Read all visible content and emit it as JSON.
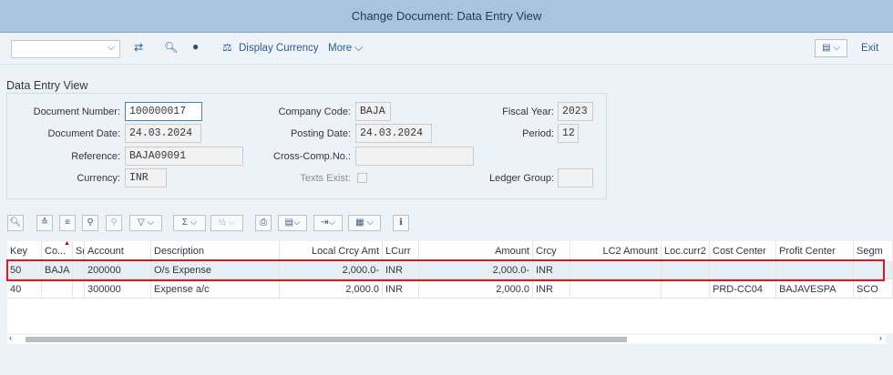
{
  "title": "Change Document: Data Entry View",
  "toolbar": {
    "display_currency": "Display Currency",
    "more": "More",
    "exit": "Exit"
  },
  "section_title": "Data Entry View",
  "header": {
    "document_number_label": "Document Number:",
    "document_number": "100000017",
    "company_code_label": "Company Code:",
    "company_code": "BAJA",
    "fiscal_year_label": "Fiscal Year:",
    "fiscal_year": "2023",
    "document_date_label": "Document Date:",
    "document_date": "24.03.2024",
    "posting_date_label": "Posting Date:",
    "posting_date": "24.03.2024",
    "period_label": "Period:",
    "period": "12",
    "reference_label": "Reference:",
    "reference": "BAJA09091",
    "cross_comp_label": "Cross-Comp.No.:",
    "cross_comp": "",
    "currency_label": "Currency:",
    "currency": "INR",
    "texts_exist_label": "Texts Exist:",
    "ledger_group_label": "Ledger Group:",
    "ledger_group": ""
  },
  "table": {
    "columns": [
      "Key",
      "Co...",
      "S(",
      "Account",
      "Description",
      "Local Crcy Amt",
      "LCurr",
      "Amount",
      "Crcy",
      "LC2 Amount",
      "Loc.curr2",
      "Cost Center",
      "Profit Center",
      "Segm"
    ],
    "rows": [
      [
        "50",
        "BAJA",
        "",
        "200000",
        "O/s Expense",
        "2,000.0-",
        "INR",
        "2,000.0-",
        "INR",
        "",
        "",
        "",
        "",
        ""
      ],
      [
        "40",
        "",
        "",
        "300000",
        "Expense a/c",
        "2,000.0",
        "INR",
        "2,000.0",
        "INR",
        "",
        "",
        "PRD-CC04",
        "BAJAVESPA",
        "SCO"
      ]
    ]
  }
}
